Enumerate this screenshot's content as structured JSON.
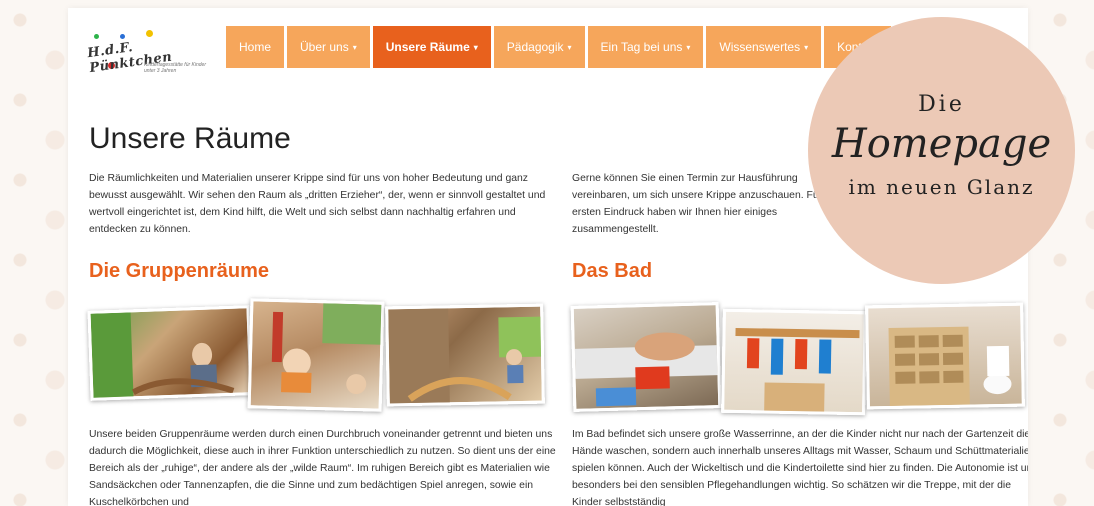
{
  "logo": {
    "title": "H.d.F. Pünktchen",
    "subtitle": "Kindertagesstätte für Kinder unter 3 Jahren"
  },
  "nav": {
    "items": [
      {
        "label": "Home",
        "dropdown": false,
        "active": false
      },
      {
        "label": "Über uns",
        "dropdown": true,
        "active": false
      },
      {
        "label": "Unsere Räume",
        "dropdown": true,
        "active": true
      },
      {
        "label": "Pädagogik",
        "dropdown": true,
        "active": false
      },
      {
        "label": "Ein Tag bei uns",
        "dropdown": true,
        "active": false
      },
      {
        "label": "Wissenswertes",
        "dropdown": true,
        "active": false
      },
      {
        "label": "Kontakt",
        "dropdown": false,
        "active": false
      }
    ],
    "caret": "▾"
  },
  "page": {
    "title": "Unsere Räume",
    "intro_left": "Die Räumlichkeiten und Materialien unserer Krippe sind für uns von hoher Bedeutung und ganz bewusst ausgewählt. Wir sehen den Raum als „dritten Erzieher“, der, wenn er sinnvoll gestaltet und wertvoll eingerichtet ist, dem Kind hilft, die Welt und sich selbst dann nachhaltig erfahren und entdecken zu können.",
    "intro_right": "Gerne können Sie einen Termin zur Hausführung vereinbaren, um sich unsere Krippe anzuschauen. Für einen ersten Eindruck haben wir Ihnen hier einiges zusammengestellt."
  },
  "sections": [
    {
      "heading": "Die Gruppenräume",
      "text": "Unsere beiden Gruppenräume werden durch einen Durchbruch voneinander getrennt und bieten uns dadurch die Möglichkeit, diese auch in ihrer Funktion unterschiedlich zu nutzen. So dient uns der eine Bereich als der „ruhige“, der andere als der „wilde Raum“. Im ruhigen Bereich gibt es Materialien wie Sandsäckchen oder Tannenzapfen, die die Sinne und zum bedächtigen Spiel anregen, sowie ein Kuschelkörbchen und"
    },
    {
      "heading": "Das Bad",
      "text": "Im Bad befindet sich unsere große Wasserrinne, an der die Kinder nicht nur nach der Gartenzeit die Hände waschen, sondern auch innerhalb unseres Alltags mit Wasser, Schaum und Schüttmaterialien spielen können. Auch der Wickeltisch und die Kindertoilette sind hier zu finden. Die Autonomie ist uns besonders bei den sensiblen Pflegehandlungen wichtig. So schätzen wir die Treppe, mit der die Kinder selbstständig"
    }
  ],
  "badge": {
    "line1": "Die",
    "line2": "Homepage",
    "line3": "im neuen Glanz"
  },
  "colors": {
    "nav": "#f6a65b",
    "nav_active": "#e8611d",
    "heading": "#e8611d",
    "badge": "#ecc9b6"
  }
}
